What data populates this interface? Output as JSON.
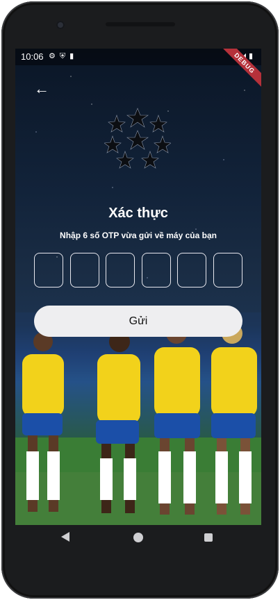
{
  "status_bar": {
    "time": "10:06",
    "left_icons": [
      "gear-icon",
      "shield-icon",
      "sd-card-icon"
    ],
    "right_icons": [
      "wifi-icon",
      "signal-icon",
      "battery-icon"
    ],
    "debug_banner": "DEBUG"
  },
  "header": {
    "back_icon": "arrow-back-icon",
    "logo": "starball-logo"
  },
  "verification": {
    "title": "Xác thực",
    "subtitle": "Nhập 6 số OTP vừa gửi về máy của bạn",
    "otp_digits": [
      "",
      "",
      "",
      "",
      "",
      ""
    ],
    "submit_label": "Gửi"
  },
  "nav_bar": {
    "icons": [
      "nav-back-icon",
      "nav-home-icon",
      "nav-recent-icon"
    ]
  },
  "colors": {
    "background_top": "#0b1626",
    "field_border": "#e8e8ef",
    "button_bg": "#eeeef0",
    "jersey_yellow": "#f2d21b",
    "shorts_blue": "#1b4fa8",
    "debug_red": "#b5313a"
  }
}
